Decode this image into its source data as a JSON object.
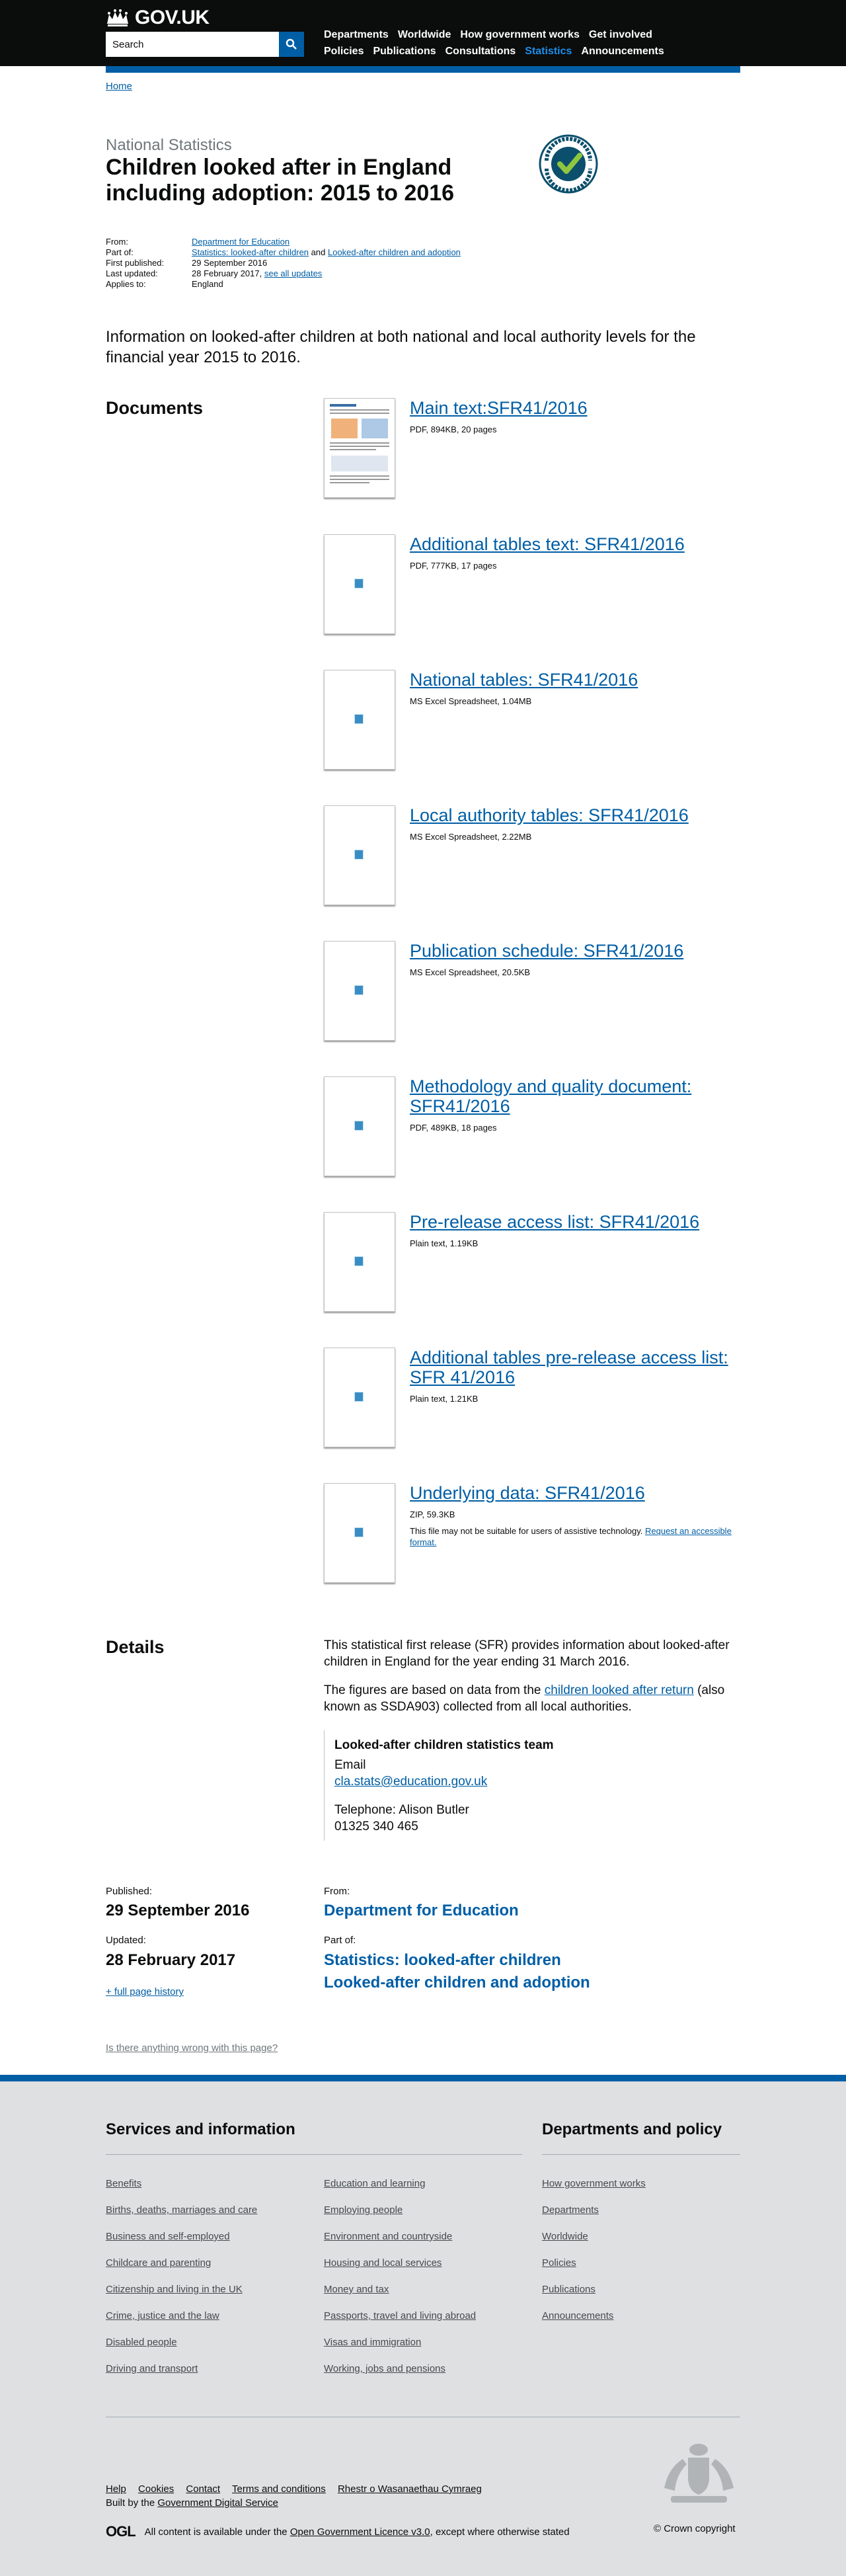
{
  "header": {
    "logo_text": "GOV.UK",
    "search_placeholder": "Search",
    "nav_row1": [
      "Departments",
      "Worldwide",
      "How government works",
      "Get involved"
    ],
    "nav_row2": [
      "Policies",
      "Publications",
      "Consultations",
      "Statistics",
      "Announcements"
    ],
    "active_nav": "Statistics"
  },
  "breadcrumb": "Home",
  "title": {
    "context": "National Statistics",
    "heading": "Children looked after in England including adoption: 2015 to 2016"
  },
  "metadata": {
    "from_label": "From:",
    "from_value": "Department for Education",
    "partof_label": "Part of:",
    "partof_link1": "Statistics: looked-after children",
    "partof_and": "and",
    "partof_link2": "Looked-after children and adoption",
    "first_published_label": "First published:",
    "first_published_value": "29 September 2016",
    "last_updated_label": "Last updated:",
    "last_updated_value": "28 February 2017,",
    "see_all_updates": "see all updates",
    "applies_label": "Applies to:",
    "applies_value": "England"
  },
  "summary": "Information on looked-after children at both national and local authority levels for the financial year 2015 to 2016.",
  "documents_heading": "Documents",
  "documents": [
    {
      "title": "Main text:SFR41/2016",
      "meta": "PDF, 894KB, 20 pages"
    },
    {
      "title": "Additional tables text: SFR41/2016",
      "meta": "PDF, 777KB, 17 pages"
    },
    {
      "title": "National tables: SFR41/2016",
      "meta": "MS Excel Spreadsheet, 1.04MB"
    },
    {
      "title": "Local authority tables: SFR41/2016",
      "meta": "MS Excel Spreadsheet, 2.22MB"
    },
    {
      "title": "Publication schedule: SFR41/2016",
      "meta": "MS Excel Spreadsheet, 20.5KB"
    },
    {
      "title": "Methodology and quality document: SFR41/2016",
      "meta": "PDF, 489KB, 18 pages"
    },
    {
      "title": "Pre-release access list: SFR41/2016",
      "meta": "Plain text, 1.19KB"
    },
    {
      "title": "Additional tables pre-release access list: SFR 41/2016",
      "meta": "Plain text, 1.21KB"
    },
    {
      "title": "Underlying data: SFR41/2016",
      "meta": "ZIP, 59.3KB",
      "note": "This file may not be suitable for users of assistive technology.",
      "note_link": "Request an accessible format."
    }
  ],
  "details": {
    "heading": "Details",
    "para1": "This statistical first release (SFR) provides information about looked-after children in England for the year ending 31 March 2016.",
    "para2_before": "The figures are based on data from the",
    "para2_link": "children looked after return",
    "para2_after": "(also known as SSDA903) collected from all local authorities.",
    "contact_title": "Looked-after children statistics team",
    "contact_email_label": "Email",
    "contact_email": "cla.stats@education.gov.uk",
    "contact_phone_label": "Telephone: Alison Butler",
    "contact_phone": "01325 340 465"
  },
  "pub_meta": {
    "published_label": "Published:",
    "published_value": "29 September 2016",
    "updated_label": "Updated:",
    "updated_value": "28 February 2017",
    "history_link": "+ full page history",
    "from_label": "From:",
    "from_value": "Department for Education",
    "partof_label": "Part of:",
    "partof_1": "Statistics: looked-after children",
    "partof_2": "Looked-after children and adoption"
  },
  "report_problem": "Is there anything wrong with this page?",
  "footer": {
    "services_heading": "Services and information",
    "services_col1": [
      "Benefits",
      "Births, deaths, marriages and care",
      "Business and self-employed",
      "Childcare and parenting",
      "Citizenship and living in the UK",
      "Crime, justice and the law",
      "Disabled people",
      "Driving and transport"
    ],
    "services_col2": [
      "Education and learning",
      "Employing people",
      "Environment and countryside",
      "Housing and local services",
      "Money and tax",
      "Passports, travel and living abroad",
      "Visas and immigration",
      "Working, jobs and pensions"
    ],
    "dept_heading": "Departments and policy",
    "dept_links": [
      "How government works",
      "Departments",
      "Worldwide",
      "Policies",
      "Publications",
      "Announcements"
    ],
    "meta_links": [
      "Help",
      "Cookies",
      "Contact",
      "Terms and conditions",
      "Rhestr o Wasanaethau Cymraeg"
    ],
    "built_by_prefix": "Built by the",
    "built_by_link": "Government Digital Service",
    "ogl": "OGL",
    "licence_before": "All content is available under the",
    "licence_link": "Open Government Licence v3.0",
    "licence_after": ", except where otherwise stated",
    "copyright": "© Crown copyright"
  },
  "colors": {
    "link": "#005ea5",
    "header_bg": "#0b0c0c",
    "footer_bg": "#dee0e2",
    "active_nav": "#1d8feb"
  }
}
